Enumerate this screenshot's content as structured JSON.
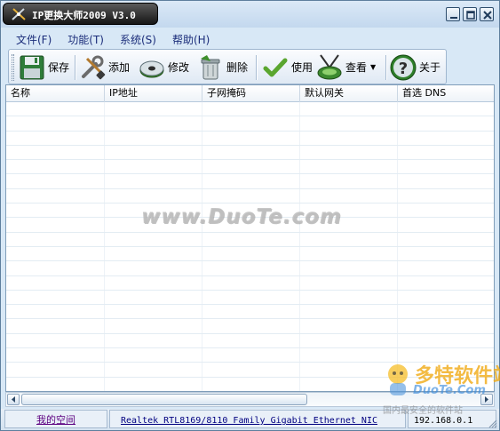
{
  "window": {
    "title": "IP更换大师2009 V3.0"
  },
  "menu": {
    "items": [
      {
        "label": "文件(F)"
      },
      {
        "label": "功能(T)"
      },
      {
        "label": "系统(S)"
      },
      {
        "label": "帮助(H)"
      }
    ]
  },
  "toolbar": {
    "save_label": "保存",
    "add_label": "添加",
    "edit_label": "修改",
    "delete_label": "删除",
    "use_label": "使用",
    "view_label": "查看",
    "about_label": "关于"
  },
  "list": {
    "columns": [
      "名称",
      "IP地址",
      "子网掩码",
      "默认网关",
      "首选 DNS"
    ],
    "rows": []
  },
  "watermark": {
    "text": "www.DuoTe.com",
    "logo_text": "多特软件站",
    "logo_sub": "DuoTe.Com",
    "logo_caption": "国内最安全的软件站"
  },
  "statusbar": {
    "link_label": "我的空间",
    "adapter": "Realtek RTL8169/8110 Family Gigabit Ethernet NIC",
    "ip": "192.168.0.1"
  },
  "icons": {
    "app": "app-icon",
    "minimize": "minimize-icon",
    "restore": "restore-icon",
    "close": "close-icon",
    "save": "floppy-disk-icon",
    "add": "wrench-brush-icon",
    "edit": "edit-disc-icon",
    "delete": "trash-bin-icon",
    "use": "check-mark-icon",
    "view": "satellite-dish-icon",
    "about": "question-mark-icon"
  },
  "colors": {
    "window_bg": "#d8e8f6",
    "title_bg": "#222222",
    "menu_text": "#1b2d7a",
    "status_link": "#5c0080"
  }
}
